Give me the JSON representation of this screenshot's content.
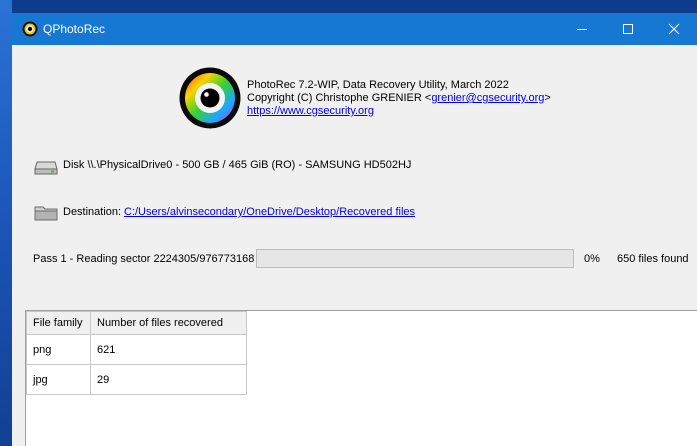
{
  "window": {
    "title": "QPhotoRec"
  },
  "info": {
    "line1": "PhotoRec 7.2-WIP, Data Recovery Utility, March 2022",
    "copyright_prefix": "Copyright (C) Christophe GRENIER <",
    "email": "grenier@cgsecurity.org",
    "copyright_suffix": ">",
    "website": "https://www.cgsecurity.org"
  },
  "disk": {
    "label": "Disk \\\\.\\PhysicalDrive0 - 500 GB / 465 GiB (RO) - SAMSUNG HD502HJ"
  },
  "destination": {
    "label": "Destination:",
    "path": "C:/Users/alvinsecondary/OneDrive/Desktop/Recovered files"
  },
  "status": {
    "pass_text": "Pass 1 - Reading sector 2224305/976773168",
    "percent": "0%",
    "progress_fraction": 0.0,
    "files_found": "650 files found"
  },
  "table": {
    "headers": [
      "File family",
      "Number of files recovered"
    ],
    "rows": [
      [
        "png",
        "621"
      ],
      [
        "jpg",
        "29"
      ]
    ]
  },
  "colors": {
    "titlebar": "#1778d4",
    "window_bg": "#f0f0f0",
    "link": "#0000ee"
  }
}
